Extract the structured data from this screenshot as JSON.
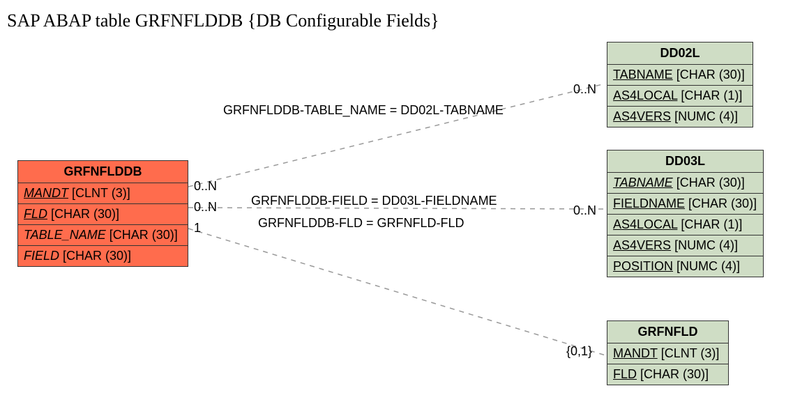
{
  "title": "SAP ABAP table GRFNFLDDB {DB Configurable Fields}",
  "entities": {
    "main": {
      "name": "GRFNFLDDB",
      "fields": [
        {
          "name": "MANDT",
          "type": "[CLNT (3)]"
        },
        {
          "name": "FLD",
          "type": "[CHAR (30)]"
        },
        {
          "name": "TABLE_NAME",
          "type": "[CHAR (30)]"
        },
        {
          "name": "FIELD",
          "type": "[CHAR (30)]"
        }
      ]
    },
    "dd02l": {
      "name": "DD02L",
      "fields": [
        {
          "name": "TABNAME",
          "type": "[CHAR (30)]"
        },
        {
          "name": "AS4LOCAL",
          "type": "[CHAR (1)]"
        },
        {
          "name": "AS4VERS",
          "type": "[NUMC (4)]"
        }
      ]
    },
    "dd03l": {
      "name": "DD03L",
      "fields": [
        {
          "name": "TABNAME",
          "type": "[CHAR (30)]"
        },
        {
          "name": "FIELDNAME",
          "type": "[CHAR (30)]"
        },
        {
          "name": "AS4LOCAL",
          "type": "[CHAR (1)]"
        },
        {
          "name": "AS4VERS",
          "type": "[NUMC (4)]"
        },
        {
          "name": "POSITION",
          "type": "[NUMC (4)]"
        }
      ]
    },
    "grfnfld": {
      "name": "GRFNFLD",
      "fields": [
        {
          "name": "MANDT",
          "type": "[CLNT (3)]"
        },
        {
          "name": "FLD",
          "type": "[CHAR (30)]"
        }
      ]
    }
  },
  "relations": {
    "r1": {
      "label": "GRFNFLDDB-TABLE_NAME = DD02L-TABNAME",
      "card_left": "0..N",
      "card_right": "0..N"
    },
    "r2": {
      "label": "GRFNFLDDB-FIELD = DD03L-FIELDNAME",
      "card_left": "0..N",
      "card_right": "0..N"
    },
    "r3": {
      "label": "GRFNFLDDB-FLD = GRFNFLD-FLD",
      "card_left": "1",
      "card_right": "{0,1}"
    }
  }
}
